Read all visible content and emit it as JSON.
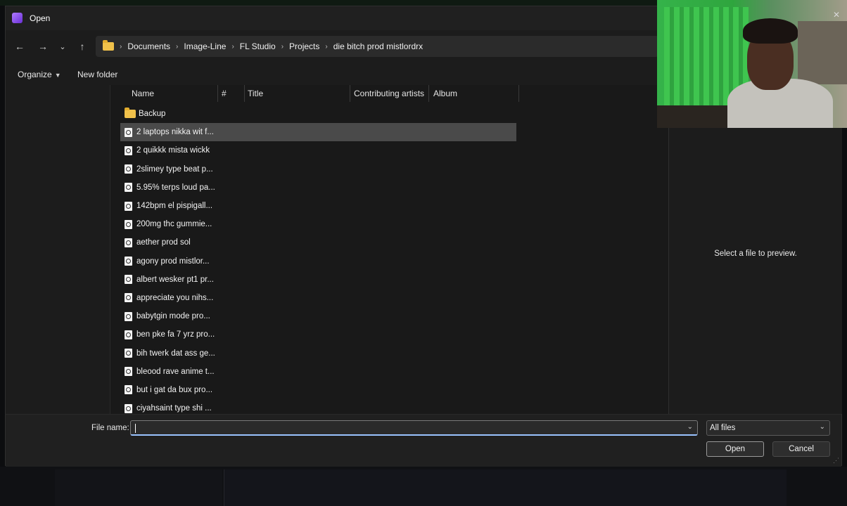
{
  "dialog": {
    "title": "Open"
  },
  "navigation": {
    "back_icon": "←",
    "forward_icon": "→",
    "recent_icon": "⌄",
    "up_icon": "↑",
    "breadcrumbs": [
      "Documents",
      "Image-Line",
      "FL Studio",
      "Projects",
      "die bitch prod mistlordrx"
    ],
    "separator": "›"
  },
  "toolbar": {
    "organize_label": "Organize",
    "new_folder_label": "New folder"
  },
  "columns": {
    "name": "Name",
    "number": "#",
    "title": "Title",
    "contributing_artists": "Contributing artists",
    "album": "Album"
  },
  "files": [
    {
      "name": "Backup",
      "type": "folder",
      "selected": false
    },
    {
      "name": "2 laptops nikka wit f...",
      "type": "file",
      "selected": true
    },
    {
      "name": "2 quikkk mista wickk",
      "type": "file",
      "selected": false
    },
    {
      "name": "2slimey type beat p...",
      "type": "file",
      "selected": false
    },
    {
      "name": "5.95% terps loud pa...",
      "type": "file",
      "selected": false
    },
    {
      "name": "142bpm el pispigall...",
      "type": "file",
      "selected": false
    },
    {
      "name": "200mg thc gummie...",
      "type": "file",
      "selected": false
    },
    {
      "name": "aether prod sol",
      "type": "file",
      "selected": false
    },
    {
      "name": "agony prod mistlor...",
      "type": "file",
      "selected": false
    },
    {
      "name": "albert wesker pt1 pr...",
      "type": "file",
      "selected": false
    },
    {
      "name": "appreciate you nihs...",
      "type": "file",
      "selected": false
    },
    {
      "name": "babytgin mode pro...",
      "type": "file",
      "selected": false
    },
    {
      "name": "ben pke fa 7 yrz pro...",
      "type": "file",
      "selected": false
    },
    {
      "name": "bih twerk dat ass ge...",
      "type": "file",
      "selected": false
    },
    {
      "name": "bleood rave anime t...",
      "type": "file",
      "selected": false
    },
    {
      "name": "but i gat da bux pro...",
      "type": "file",
      "selected": false
    },
    {
      "name": "ciyahsaint type shi ...",
      "type": "file",
      "selected": false
    }
  ],
  "preview": {
    "message": "Select a file to preview."
  },
  "footer": {
    "file_name_label": "File name:",
    "file_name_value": "",
    "file_type_filter": "All files",
    "open_label": "Open",
    "cancel_label": "Cancel"
  },
  "colors": {
    "dialog_bg": "#1c1c1c",
    "selected_row": "#4a4a4a",
    "folder": "#f0c14a",
    "focus_underline": "#9ac3ff"
  }
}
